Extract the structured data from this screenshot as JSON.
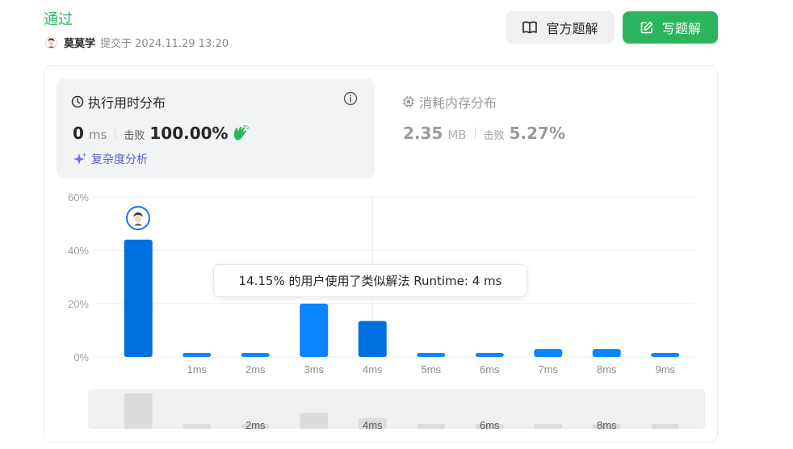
{
  "header": {
    "status": "通过",
    "user_name": "莫莫学",
    "submitted_text": "提交于 2024.11.29 13:20",
    "official_solution_label": "官方题解",
    "write_solution_label": "写题解"
  },
  "runtime_card": {
    "title": "执行用时分布",
    "value": "0",
    "unit": "ms",
    "beat_label": "击败",
    "beat_value": "100.00%",
    "complexity_label": "复杂度分析"
  },
  "memory_card": {
    "title": "消耗内存分布",
    "value": "2.35",
    "unit": "MB",
    "beat_label": "击败",
    "beat_value": "5.27%"
  },
  "tooltip": {
    "text": "14.15% 的用户使用了类似解法 Runtime: 4 ms"
  },
  "colors": {
    "accent_green": "#2db55d",
    "bar_blue": "#0a84ff",
    "bar_blue_dark": "#006fe0",
    "complexity_purple": "#5b5fc7"
  },
  "chart_data": {
    "type": "bar",
    "categories": [
      "",
      "1ms",
      "2ms",
      "3ms",
      "4ms",
      "5ms",
      "6ms",
      "7ms",
      "8ms",
      "9ms"
    ],
    "values": [
      44,
      1.5,
      1.5,
      20,
      13.5,
      1.5,
      1.5,
      3,
      3,
      1.5
    ],
    "ylim": [
      0,
      60
    ],
    "yticks": [
      "0%",
      "20%",
      "40%",
      "60%"
    ],
    "grid": true,
    "highlighted_index": 0,
    "hover_index": 4
  },
  "brush": {
    "labels": [
      "2ms",
      "4ms",
      "6ms",
      "8ms"
    ]
  }
}
